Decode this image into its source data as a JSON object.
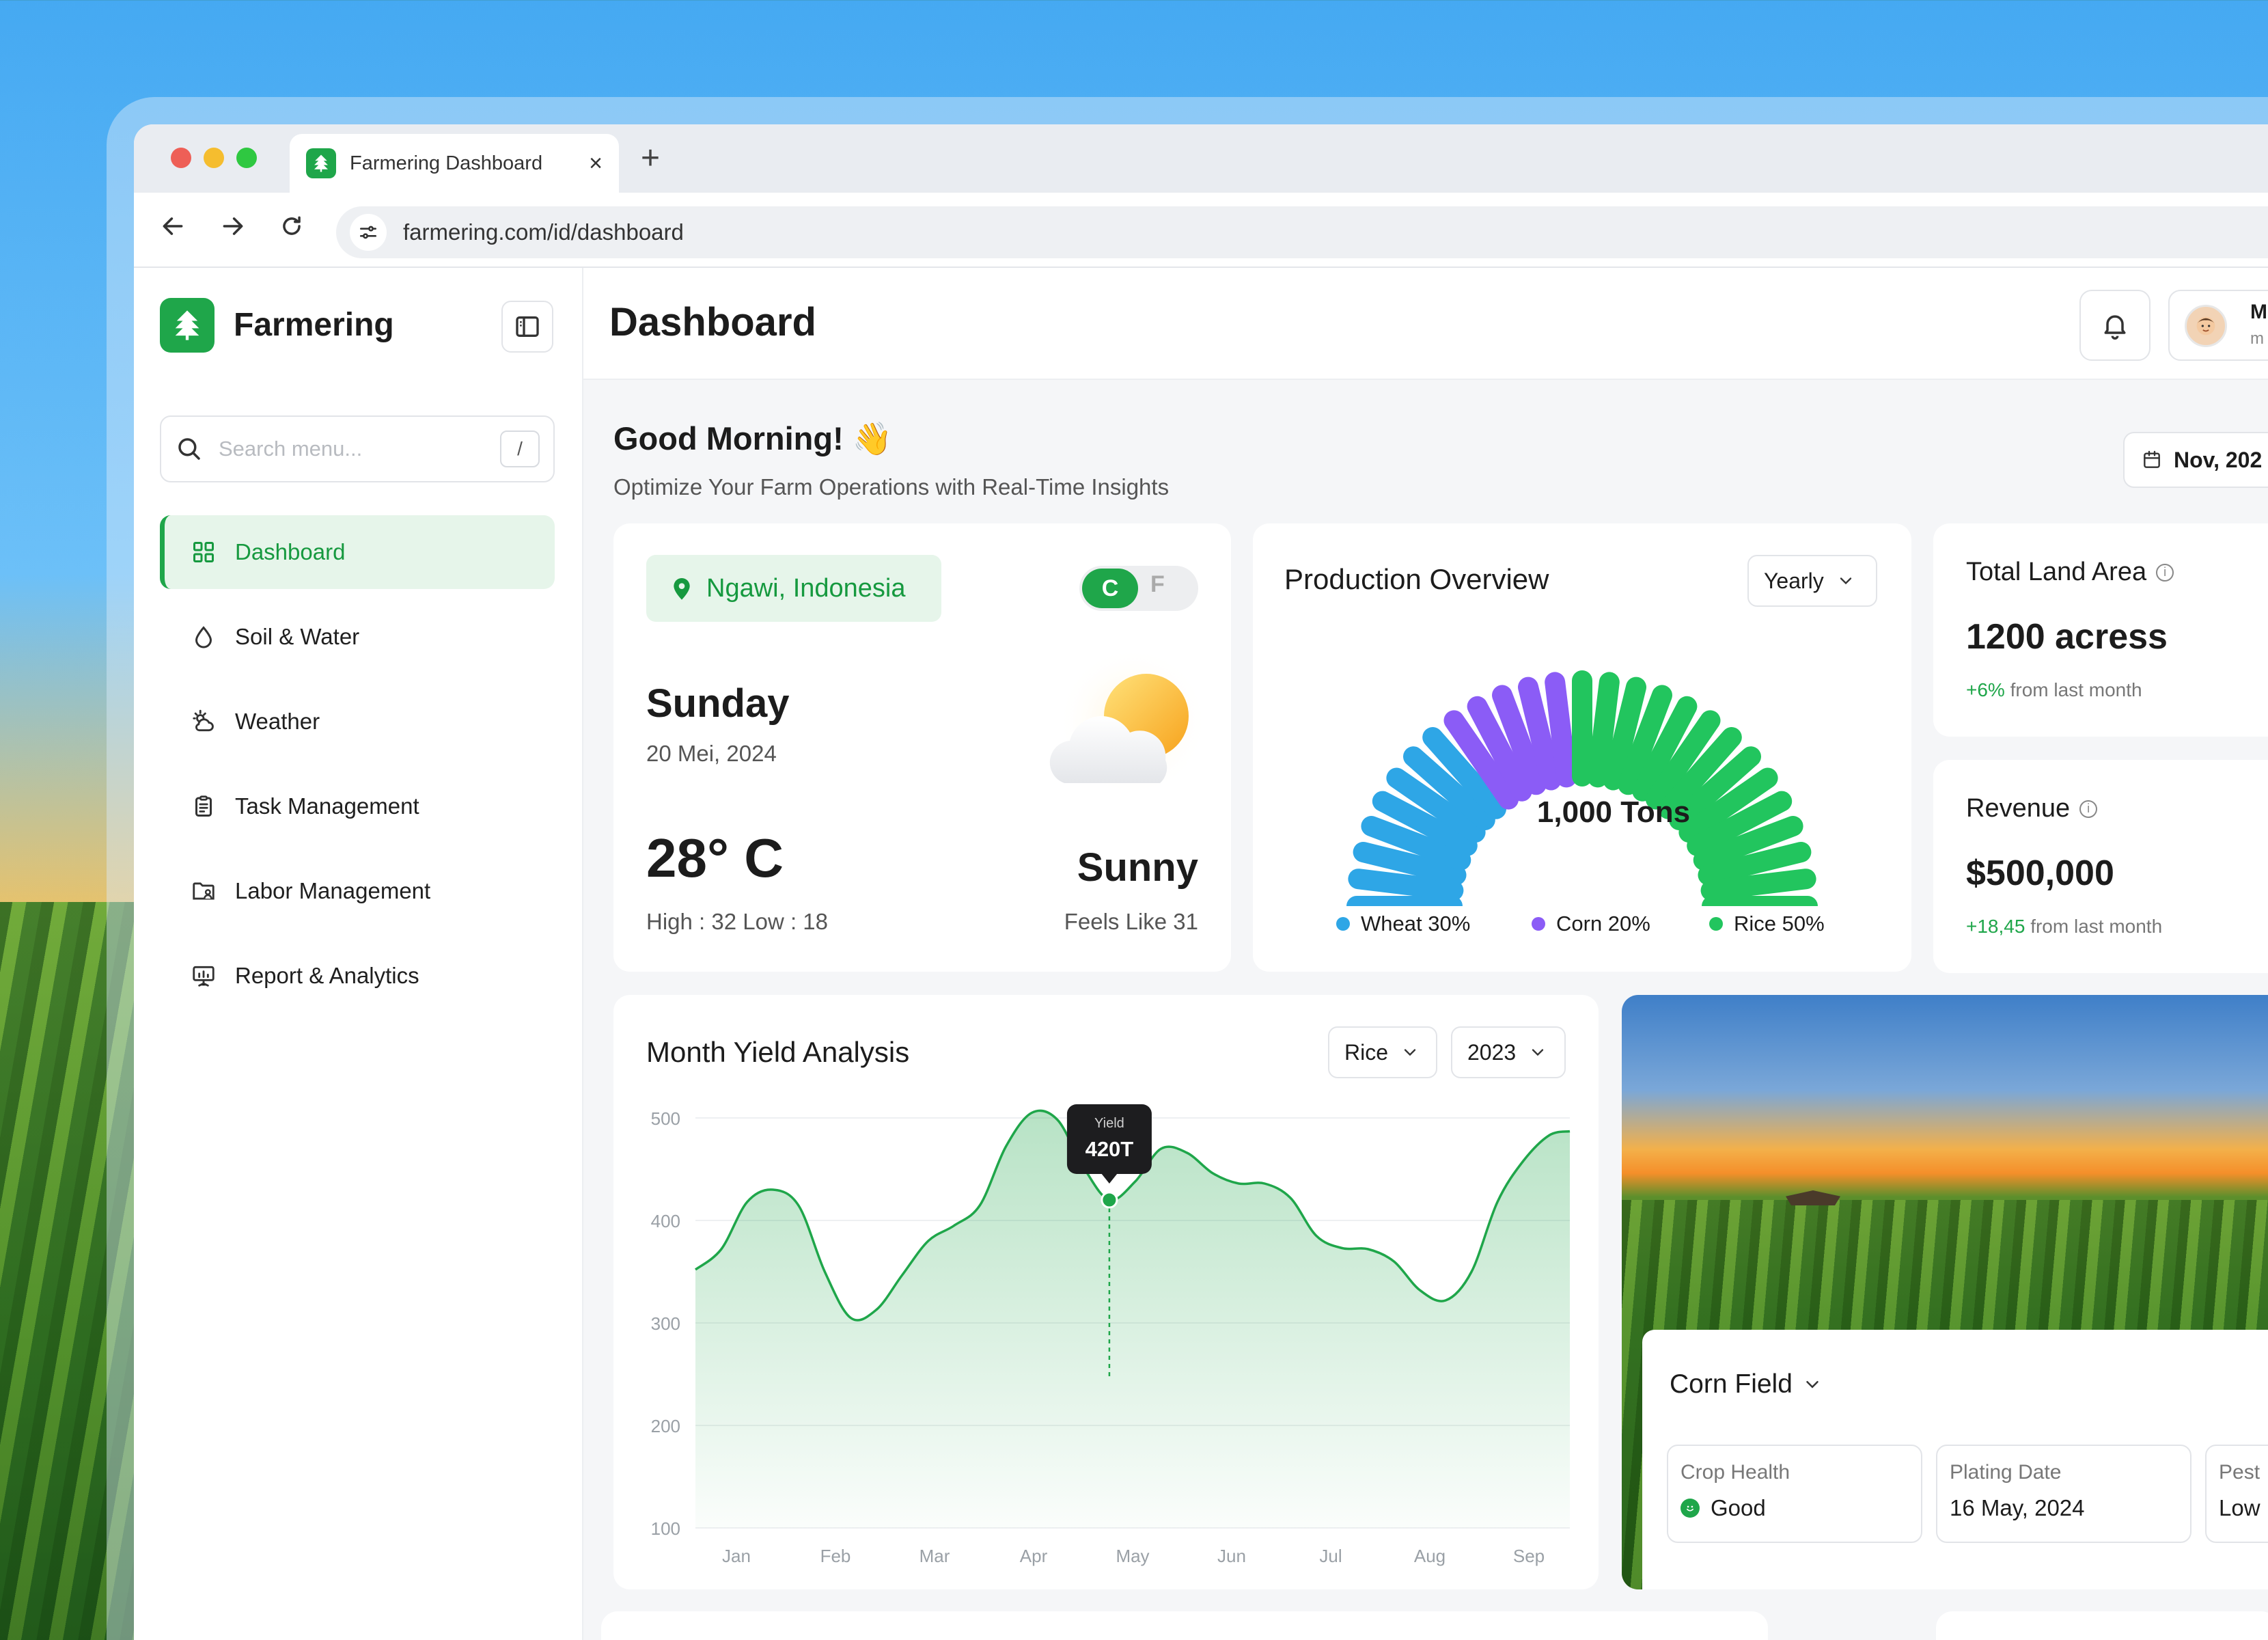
{
  "browser": {
    "tab_title": "Farmering Dashboard",
    "tab_close": "×",
    "new_tab": "+",
    "url": "farmering.com/id/dashboard"
  },
  "sidebar": {
    "brand": "Farmering",
    "search_placeholder": "Search menu...",
    "search_shortcut": "/",
    "items": [
      {
        "label": "Dashboard",
        "icon": "grid-icon",
        "active": true
      },
      {
        "label": "Soil & Water",
        "icon": "droplet-icon"
      },
      {
        "label": "Weather",
        "icon": "weather-icon"
      },
      {
        "label": "Task Management",
        "icon": "clipboard-icon"
      },
      {
        "label": "Labor Management",
        "icon": "folder-user-icon"
      },
      {
        "label": "Report & Analytics",
        "icon": "presentation-chart-icon"
      }
    ]
  },
  "header": {
    "title": "Dashboard",
    "user_initial": "M",
    "user_sub": "m"
  },
  "greeting": {
    "title": "Good Morning! 👋",
    "subtitle": "Optimize Your Farm Operations with Real-Time Insights",
    "date_label": "Nov, 202"
  },
  "weather": {
    "location": "Ngawi, Indonesia",
    "unit_c": "C",
    "unit_f": "F",
    "day": "Sunday",
    "date": "20 Mei, 2024",
    "temperature": "28° C",
    "high_low": "High : 32  Low : 18",
    "condition": "Sunny",
    "feels_like": "Feels Like 31"
  },
  "production": {
    "title": "Production Overview",
    "period": "Yearly",
    "total": "1,000 Tons",
    "legend": [
      {
        "label": "Wheat 30%",
        "color": "#2ea6e6",
        "share": 30
      },
      {
        "label": "Corn 20%",
        "color": "#8b5cf6",
        "share": 20
      },
      {
        "label": "Rice 50%",
        "color": "#22c55e",
        "share": 50
      }
    ]
  },
  "stats": {
    "land": {
      "label": "Total Land Area",
      "value": "1200 acress",
      "delta": "+6%",
      "delta_suffix": " from last month"
    },
    "revenue": {
      "label": "Revenue",
      "value": "$500,000",
      "delta": "+18,45",
      "delta_suffix": " from last month"
    }
  },
  "yield": {
    "title": "Month Yield Analysis",
    "crop": "Rice",
    "year": "2023",
    "tooltip_label": "Yield",
    "tooltip_value": "420T"
  },
  "chart_data": {
    "type": "area",
    "title": "Month Yield Analysis",
    "xlabel": "",
    "ylabel": "",
    "categories": [
      "Jan",
      "Feb",
      "Mar",
      "Apr",
      "May",
      "Jun",
      "Jul",
      "Aug",
      "Sep"
    ],
    "y_ticks": [
      500,
      400,
      300,
      200,
      100
    ],
    "ylim": [
      100,
      500
    ],
    "series": [
      {
        "x": [
          0,
          0.25,
          0.5,
          0.75,
          1.0,
          1.25,
          1.5,
          1.75,
          2.0,
          2.25,
          2.5,
          2.75,
          3.0,
          3.25,
          3.5,
          3.75,
          4.0,
          4.25,
          4.5,
          4.75,
          5.0,
          5.25,
          5.5,
          5.75,
          6.0,
          6.25,
          6.5,
          6.75,
          7.0,
          7.25,
          7.5,
          7.75,
          8.0,
          8.25,
          8.45
        ],
        "values": [
          352,
          372,
          418,
          430,
          414,
          350,
          305,
          313,
          347,
          380,
          395,
          415,
          472,
          505,
          498,
          452,
          420,
          438,
          470,
          466,
          446,
          436,
          436,
          422,
          385,
          373,
          372,
          360,
          332,
          322,
          350,
          418,
          458,
          483,
          487
        ]
      }
    ],
    "highlight": {
      "x": "May",
      "value": 420,
      "label": "420T"
    },
    "grid": true,
    "legend": "none"
  },
  "field": {
    "name": "Corn Field",
    "crop_health_label": "Crop Health",
    "crop_health_value": "Good",
    "planting_label": "Plating Date",
    "planting_value": "16 May, 2024",
    "pest_label": "Pest",
    "pest_value": "Low"
  },
  "colors": {
    "primary": "#1fa64a",
    "primary_light": "#e6f5ea",
    "wheat": "#2ea6e6",
    "corn": "#8b5cf6",
    "rice": "#22c55e"
  }
}
